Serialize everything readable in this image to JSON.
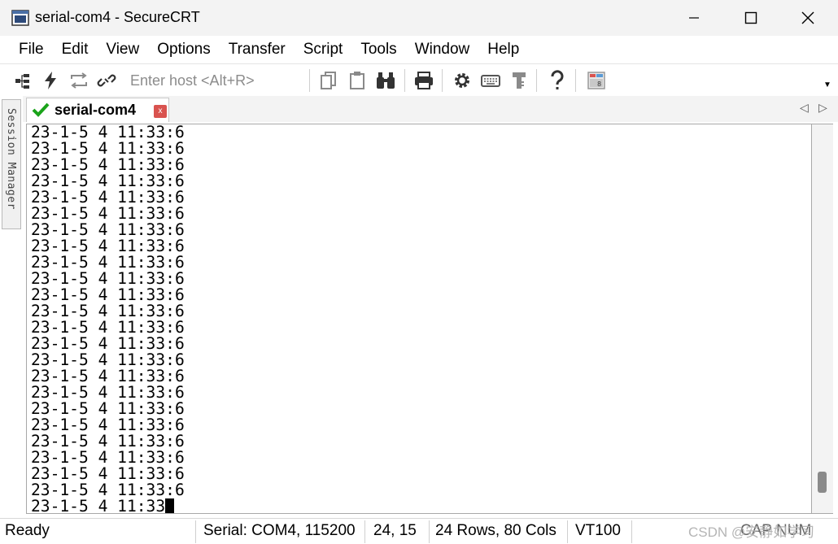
{
  "window": {
    "title": "serial-com4 - SecureCRT"
  },
  "menu": [
    "File",
    "Edit",
    "View",
    "Options",
    "Transfer",
    "Script",
    "Tools",
    "Window",
    "Help"
  ],
  "toolbar": {
    "host_placeholder": "Enter host <Alt+R>"
  },
  "sidebar": {
    "session_manager_label": "Session Manager"
  },
  "tab": {
    "label": "serial-com4",
    "close": "x"
  },
  "terminal": {
    "lines": [
      "23-1-5 4 11:33:6",
      "23-1-5 4 11:33:6",
      "23-1-5 4 11:33:6",
      "23-1-5 4 11:33:6",
      "23-1-5 4 11:33:6",
      "23-1-5 4 11:33:6",
      "23-1-5 4 11:33:6",
      "23-1-5 4 11:33:6",
      "23-1-5 4 11:33:6",
      "23-1-5 4 11:33:6",
      "23-1-5 4 11:33:6",
      "23-1-5 4 11:33:6",
      "23-1-5 4 11:33:6",
      "23-1-5 4 11:33:6",
      "23-1-5 4 11:33:6",
      "23-1-5 4 11:33:6",
      "23-1-5 4 11:33:6",
      "23-1-5 4 11:33:6",
      "23-1-5 4 11:33:6",
      "23-1-5 4 11:33:6",
      "23-1-5 4 11:33:6",
      "23-1-5 4 11:33:6",
      "23-1-5 4 11:33:6"
    ],
    "last_line": "23-1-5 4 11:33"
  },
  "status": {
    "ready": "Ready",
    "connection": "Serial: COM4, 115200",
    "cursor_pos": "24,  15",
    "dimensions": "24 Rows, 80 Cols",
    "emulation": "VT100",
    "caps": "CAP NUM",
    "watermark": "CSDN @安静如学习"
  }
}
